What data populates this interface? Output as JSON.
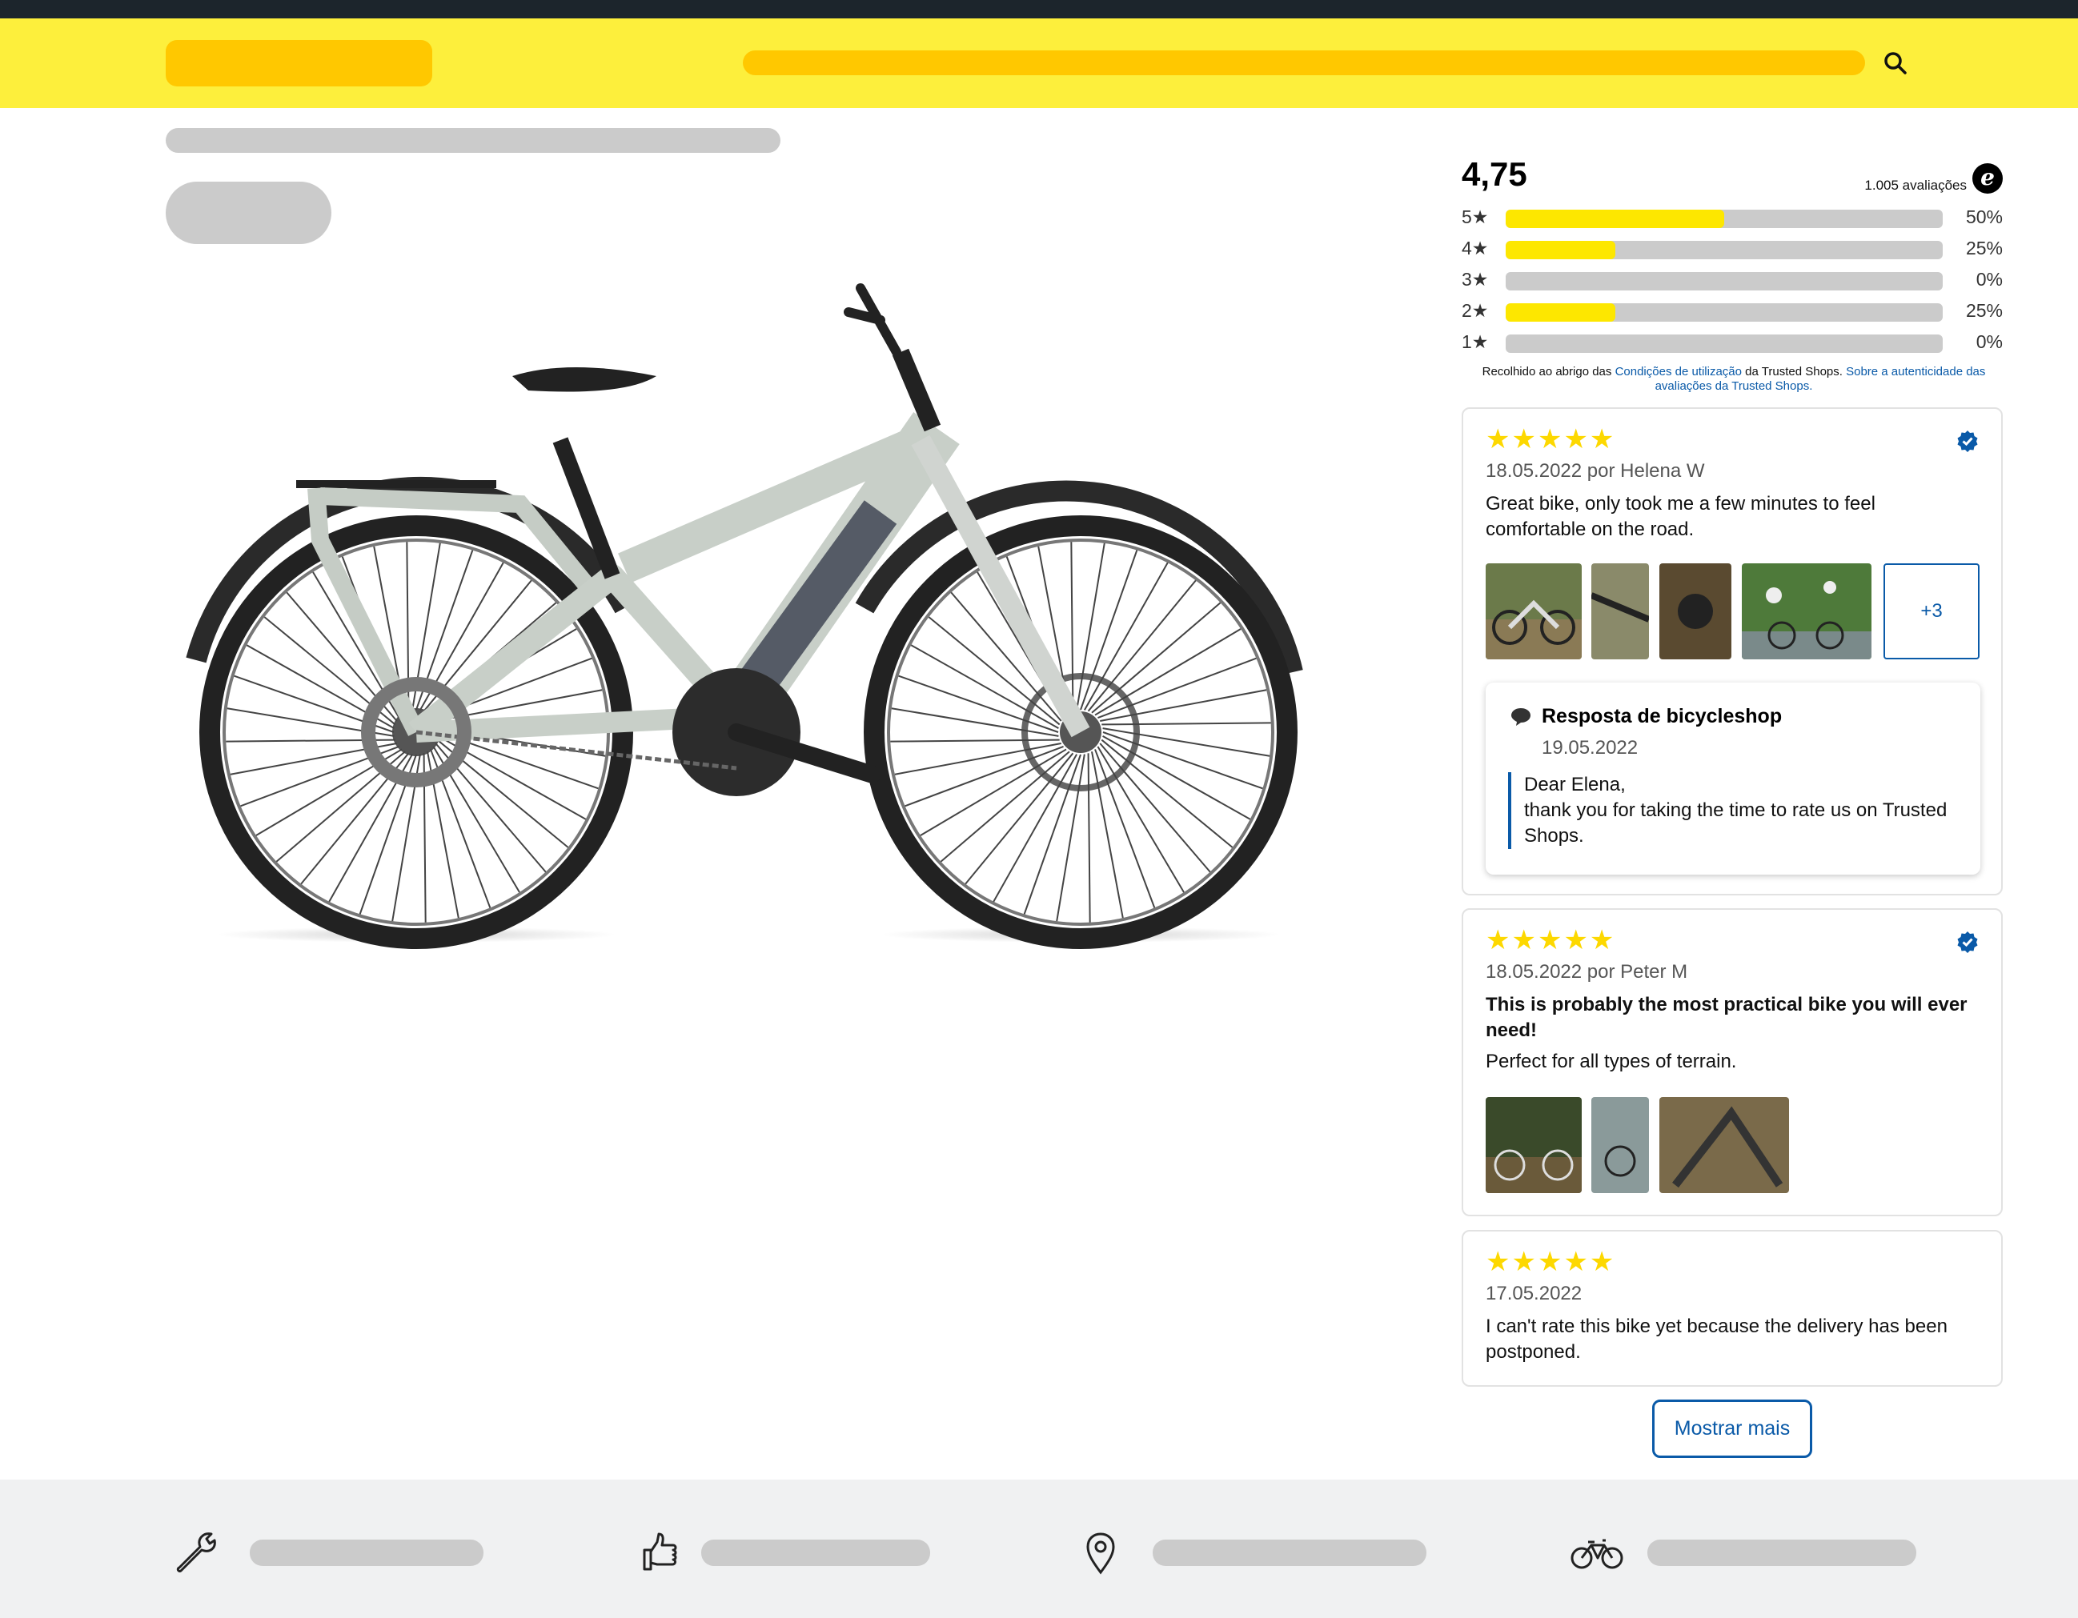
{
  "header": {
    "search_icon": "search-icon"
  },
  "rating": {
    "average": "4,75",
    "count": "1.005 avaliações",
    "logo_letter": "e",
    "distribution": [
      {
        "label": "5★",
        "percent_text": "50%",
        "percent": 50
      },
      {
        "label": "4★",
        "percent_text": "25%",
        "percent": 25
      },
      {
        "label": "3★",
        "percent_text": "0%",
        "percent": 0
      },
      {
        "label": "2★",
        "percent_text": "25%",
        "percent": 25
      },
      {
        "label": "1★",
        "percent_text": "0%",
        "percent": 0
      }
    ],
    "collected_prefix": "Recolhido ao abrigo das",
    "collected_link1": "Condições de utilização",
    "collected_middle": "da Trusted Shops.",
    "collected_link2": "Sobre a autenticidade das avaliações da Trusted Shops."
  },
  "reviews": [
    {
      "stars": "★★★★★",
      "meta": "18.05.2022 por Helena W",
      "text": "Great bike, only took me a few minutes to feel comfortable on the road.",
      "more_photos": "+3",
      "reply": {
        "title": "Resposta de bicycleshop",
        "date": "19.05.2022",
        "greeting": "Dear Elena,",
        "body": "thank you for taking the time to rate us on Trusted Shops."
      }
    },
    {
      "stars": "★★★★★",
      "meta": "18.05.2022 por Peter M",
      "title": "This is probably the most practical bike you will ever need!",
      "text": "Perfect for all types of terrain."
    },
    {
      "stars": "★★★★★",
      "meta": "17.05.2022",
      "text": "I can't rate this bike yet because the delivery has been postponed."
    }
  ],
  "show_more_label": "Mostrar mais",
  "colors": {
    "header_yellow": "#fdef3c",
    "placeholder_yellow": "#ffc800",
    "star_yellow": "#fdd800",
    "link_blue": "#0a5aa8",
    "topbar": "#1c252c",
    "footer_bg": "#f0f1f2"
  },
  "footer_icons": [
    "wrench-icon",
    "thumbs-up-icon",
    "location-pin-icon",
    "bicycle-icon"
  ]
}
